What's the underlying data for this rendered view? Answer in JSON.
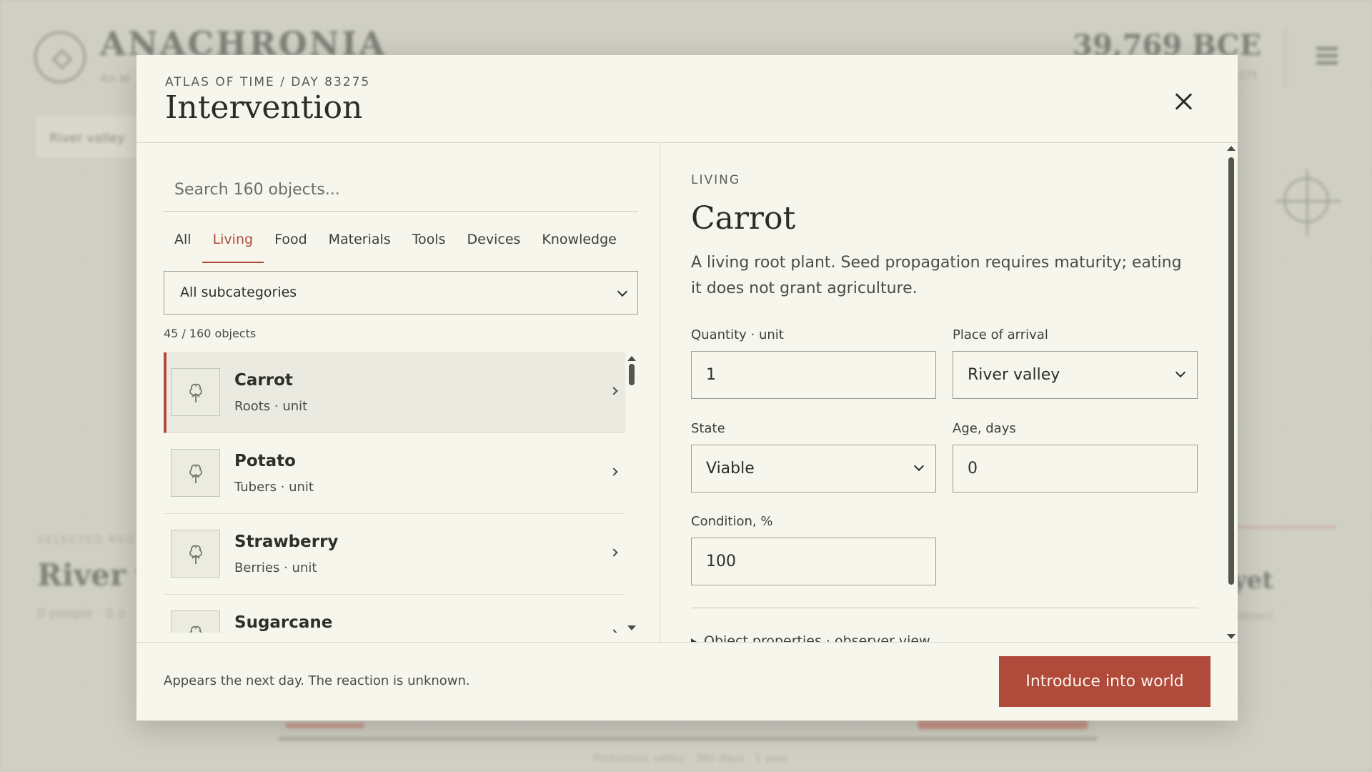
{
  "background": {
    "brand": "ANACHRONIA",
    "brand_sub": "An at",
    "year": "39,769 BCE",
    "year_sub": "275",
    "region_pill": "River valley",
    "selected_label": "SELECTED REG",
    "selected_title": "River v",
    "selected_sub": "0 people · 0 o",
    "right_title": "yet",
    "right_sub": "object",
    "bottom_text": "Prehistoric valley · 360 days · 1 year"
  },
  "modal": {
    "eyebrow": "ATLAS OF TIME / DAY 83275",
    "title": "Intervention",
    "search_placeholder": "Search 160 objects...",
    "tabs": [
      {
        "label": "All"
      },
      {
        "label": "Living",
        "active": true
      },
      {
        "label": "Food"
      },
      {
        "label": "Materials"
      },
      {
        "label": "Tools"
      },
      {
        "label": "Devices"
      },
      {
        "label": "Knowledge"
      }
    ],
    "subcategory": "All subcategories",
    "count": "45 / 160 objects",
    "items": [
      {
        "name": "Carrot",
        "sub": "Roots · unit",
        "icon": "plant-icon",
        "selected": true
      },
      {
        "name": "Potato",
        "sub": "Tubers · unit",
        "icon": "plant-icon"
      },
      {
        "name": "Strawberry",
        "sub": "Berries · unit",
        "icon": "plant-icon"
      },
      {
        "name": "Sugarcane",
        "sub": "",
        "icon": "plant-icon"
      }
    ],
    "detail": {
      "category": "LIVING",
      "title": "Carrot",
      "description": "A living root plant. Seed propagation requires maturity; eating it does not grant agriculture.",
      "quantity_label": "Quantity · unit",
      "quantity_value": "1",
      "place_label": "Place of arrival",
      "place_value": "River valley",
      "state_label": "State",
      "state_value": "Viable",
      "age_label": "Age, days",
      "age_value": "0",
      "condition_label": "Condition, %",
      "condition_value": "100",
      "props_toggle": "Object properties · observer view"
    },
    "footer_note": "Appears the next day. The reaction is unknown.",
    "primary_button": "Introduce into world"
  },
  "colors": {
    "accent": "#b04a3a",
    "modal_bg": "#f7f6ec"
  }
}
